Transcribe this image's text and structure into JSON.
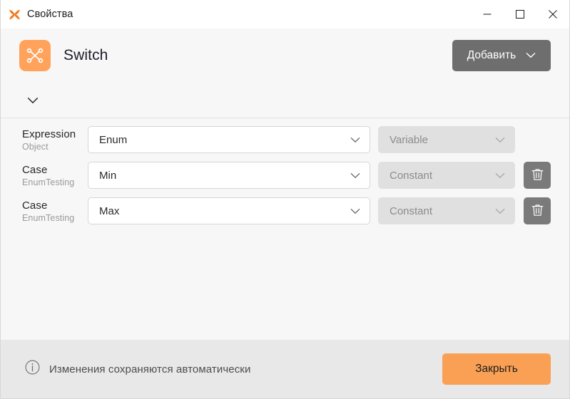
{
  "window": {
    "title": "Свойства",
    "app_icon": "butterfly-icon",
    "controls": {
      "minimize": "minimize-icon",
      "maximize": "maximize-icon",
      "close": "close-icon"
    }
  },
  "header": {
    "node_icon": "switch-node-icon",
    "node_title": "Switch",
    "add_label": "Добавить",
    "add_chevron": "chevron-down-icon",
    "collapse_chevron": "chevron-down-icon"
  },
  "colors": {
    "accent_orange": "#f9a055",
    "node_icon_bg": "#ffa35c",
    "add_button_bg": "#6e6e6e",
    "trash_button_bg": "#7a7a7a",
    "body_bg": "#f7f7f7",
    "footer_bg": "#e8e8e8",
    "disabled_field_bg": "#e0e0e0"
  },
  "form": {
    "rows": [
      {
        "label": "Expression",
        "sublabel": "Object",
        "value": "Enum",
        "value_enabled": true,
        "side_value": "Variable",
        "side_enabled": false,
        "has_delete": false,
        "delete_icon": "trash-icon"
      },
      {
        "label": "Case",
        "sublabel": "EnumTesting",
        "value": "Min",
        "value_enabled": true,
        "side_value": "Constant",
        "side_enabled": false,
        "has_delete": true,
        "delete_icon": "trash-icon"
      },
      {
        "label": "Case",
        "sublabel": "EnumTesting",
        "value": "Max",
        "value_enabled": true,
        "side_value": "Constant",
        "side_enabled": false,
        "has_delete": true,
        "delete_icon": "trash-icon"
      }
    ]
  },
  "footer": {
    "info_icon": "info-icon",
    "note": "Изменения сохраняются автоматически",
    "close_label": "Закрыть"
  }
}
